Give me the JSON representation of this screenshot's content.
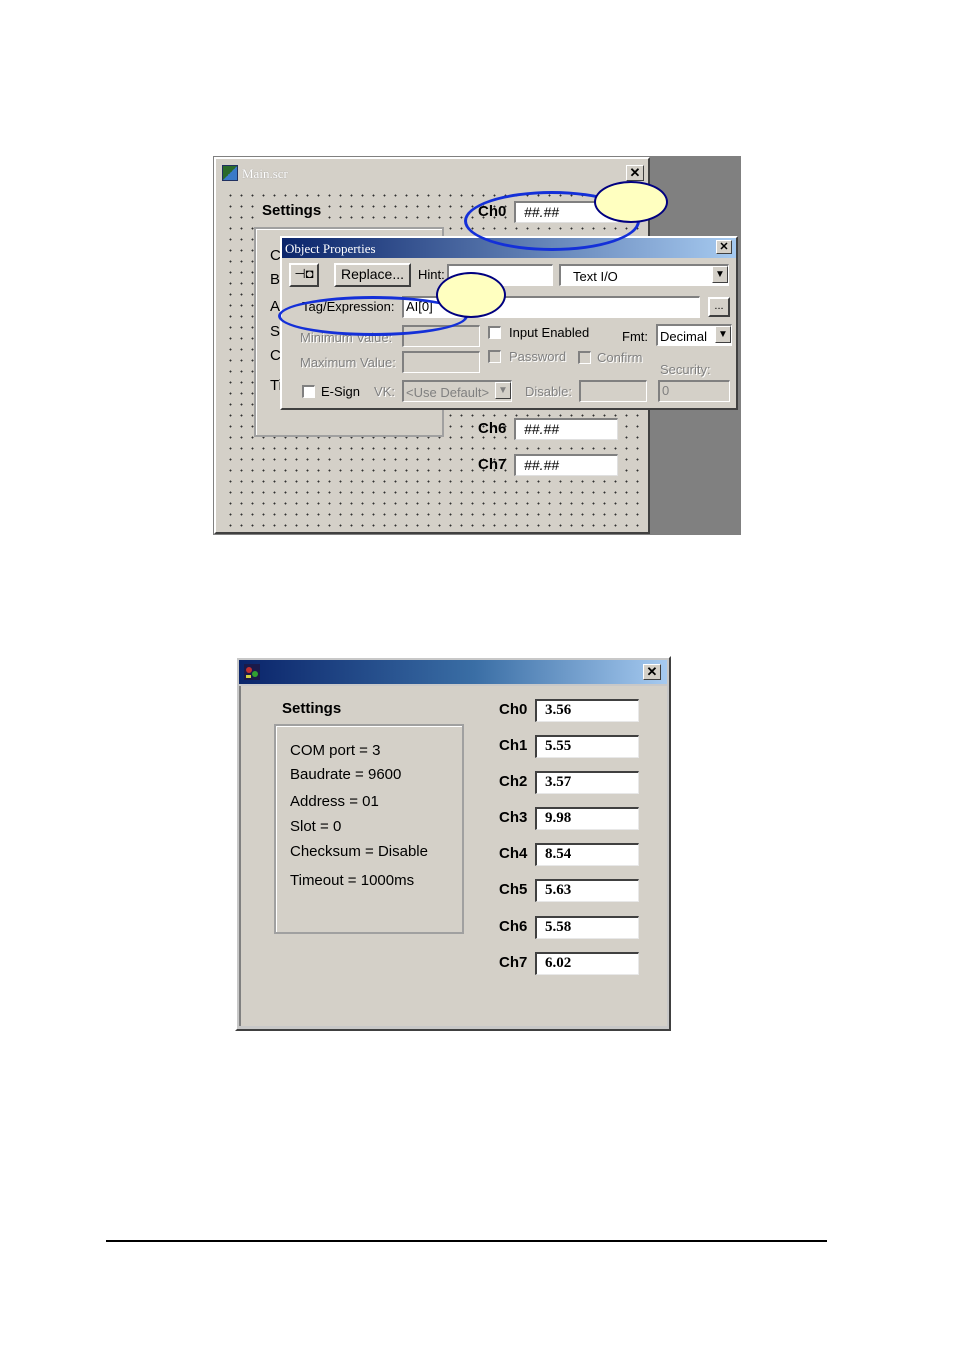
{
  "designer": {
    "window_title": "Main.scr",
    "settings_label": "Settings",
    "stub_letters": [
      "C",
      "B",
      "A",
      "S",
      "C",
      "Ti"
    ],
    "channels": [
      {
        "label": "Ch0",
        "value": "##.##"
      },
      {
        "label": "Ch6",
        "value": "##.##"
      },
      {
        "label": "Ch7",
        "value": "##.##"
      }
    ]
  },
  "dialog": {
    "title": "Object Properties",
    "replace_label": "Replace...",
    "hint_label": "Hint:",
    "hint_value": "",
    "type_value": "Text I/O",
    "tag_label": "Tag/Expression:",
    "tag_value": "AI[0]",
    "browse_label": "...",
    "min_label": "Minimum Value:",
    "max_label": "Maximum Value:",
    "input_enabled_label": "Input Enabled",
    "fmt_label": "Fmt:",
    "fmt_value": "Decimal",
    "password_label": "Password",
    "confirm_label": "Confirm",
    "security_label": "Security:",
    "security_value": "0",
    "esign_label": "E-Sign",
    "vk_label": "VK:",
    "vk_value": "<Use Default>",
    "disable_label": "Disable:"
  },
  "runtime": {
    "settings_label": "Settings",
    "settings_lines": [
      "COM port = 3",
      "Baudrate = 9600",
      "Address = 01",
      "Slot = 0",
      "Checksum = Disable",
      "Timeout = 1000ms"
    ],
    "channels": [
      {
        "label": "Ch0",
        "value": "3.56"
      },
      {
        "label": "Ch1",
        "value": "5.55"
      },
      {
        "label": "Ch2",
        "value": "3.57"
      },
      {
        "label": "Ch3",
        "value": "9.98"
      },
      {
        "label": "Ch4",
        "value": "8.54"
      },
      {
        "label": "Ch5",
        "value": "5.63"
      },
      {
        "label": "Ch6",
        "value": "5.58"
      },
      {
        "label": "Ch7",
        "value": "6.02"
      }
    ]
  },
  "colors": {
    "highlight_ellipse": "#1430d8",
    "callout_fill": "#ffffc0",
    "title_gradient_start": "#0a246a"
  }
}
